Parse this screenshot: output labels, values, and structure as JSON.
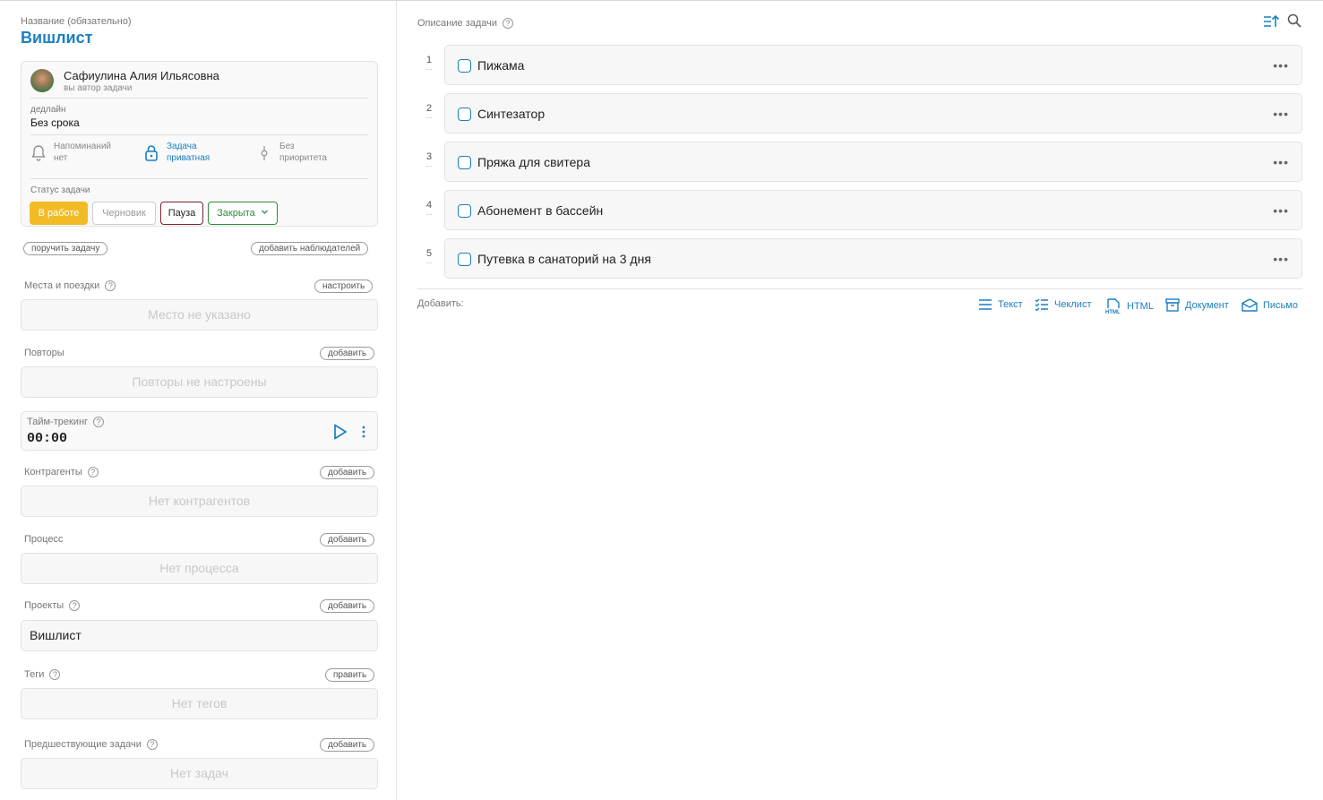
{
  "task": {
    "name_label": "Название (обязательно)",
    "name": "Вишлист"
  },
  "author": {
    "name": "Сафиулина Алия Ильясовна",
    "role": "вы автор задачи"
  },
  "deadline": {
    "label": "дедлайн",
    "value": "Без срока"
  },
  "options": {
    "reminders": [
      "Напоминаний",
      "нет"
    ],
    "privacy": [
      "Задача",
      "приватная"
    ],
    "priority": [
      "Без",
      "приоритета"
    ]
  },
  "status": {
    "label": "Статус задачи",
    "buttons": [
      "В работе",
      "Черновик",
      "Пауза",
      "Закрыта"
    ],
    "colors": {
      "active": "#f2bb25",
      "pause": "#7a2330",
      "closed": "#2e8b3a",
      "accent": "#1a7fc1"
    }
  },
  "actions": {
    "assign": "поручить задачу",
    "add_watchers": "добавить наблюдателей"
  },
  "sections": {
    "places": {
      "label": "Места и поездки",
      "btn": "настроить",
      "value": "Место не указано"
    },
    "repeats": {
      "label": "Повторы",
      "btn": "добавить",
      "value": "Повторы не настроены"
    },
    "timetracking": {
      "label": "Тайм-трекинг",
      "value": "00:00"
    },
    "contractors": {
      "label": "Контрагенты",
      "btn": "добавить",
      "value": "Нет контрагентов"
    },
    "process": {
      "label": "Процесс",
      "btn": "добавить",
      "value": "Нет процесса"
    },
    "projects": {
      "label": "Проекты",
      "btn": "добавить",
      "value": "Вишлист"
    },
    "tags": {
      "label": "Теги",
      "btn": "править",
      "value": "Нет тегов"
    },
    "predecessors": {
      "label": "Предшествующие задачи",
      "btn": "добавить",
      "value": "Нет задач"
    }
  },
  "description": {
    "label": "Описание задачи",
    "items": [
      {
        "n": "1",
        "text": "Пижама"
      },
      {
        "n": "2",
        "text": "Синтезатор"
      },
      {
        "n": "3",
        "text": "Пряжа для свитера"
      },
      {
        "n": "4",
        "text": "Абонемент в бассейн"
      },
      {
        "n": "5",
        "text": "Путевка в санаторий на 3 дня"
      }
    ],
    "add_label": "Добавить:",
    "add_buttons": [
      "Текст",
      "Чеклист",
      "HTML",
      "Документ",
      "Письмо"
    ]
  }
}
